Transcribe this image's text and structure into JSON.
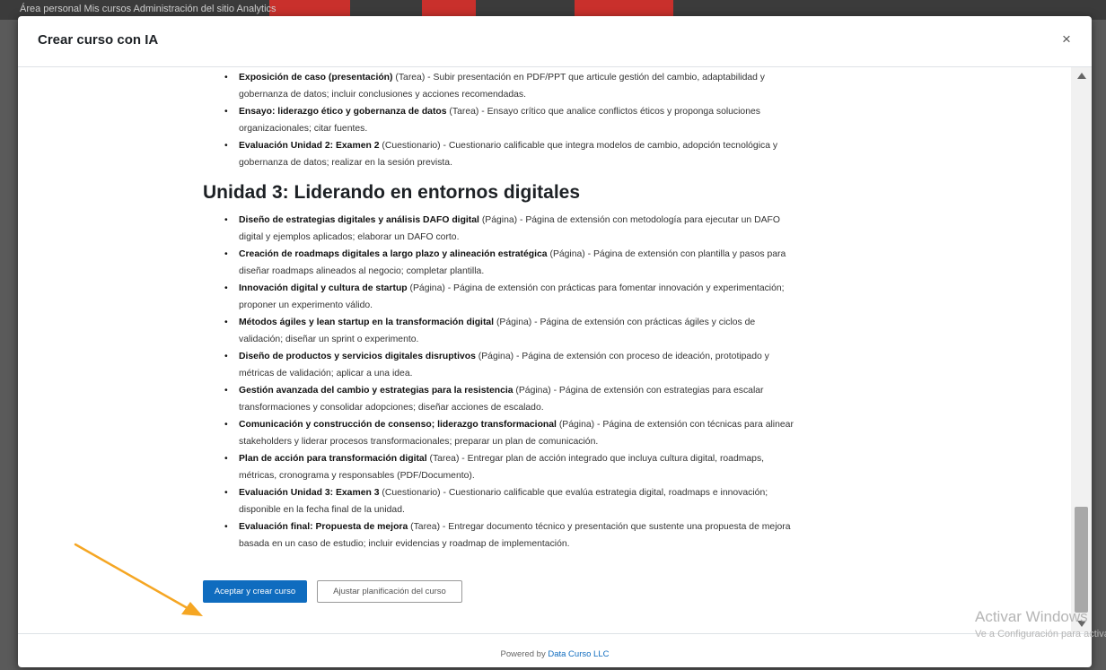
{
  "background": {
    "nav_text": "Área personal   Mis cursos   Administración del sitio   Analytics"
  },
  "modal": {
    "title": "Crear curso con IA",
    "close_label": "×"
  },
  "unit2_items": [
    {
      "title": "Exposición de caso (presentación)",
      "rest": " (Tarea) - Subir presentación en PDF/PPT que articule gestión del cambio, adaptabilidad y",
      "rest2": "gobernanza de datos; incluir conclusiones y acciones recomendadas."
    },
    {
      "title": "Ensayo: liderazgo ético y gobernanza de datos",
      "rest": " (Tarea) - Ensayo crítico que analice conflictos éticos y proponga soluciones",
      "rest2": "organizacionales; citar fuentes."
    },
    {
      "title": "Evaluación Unidad 2: Examen 2",
      "rest": " (Cuestionario) - Cuestionario calificable que integra modelos de cambio, adopción tecnológica y",
      "rest2": "gobernanza de datos; realizar en la sesión prevista."
    }
  ],
  "unit3": {
    "heading": "Unidad 3: Liderando en entornos digitales",
    "items": [
      {
        "title": "Diseño de estrategias digitales y análisis DAFO digital",
        "rest": " (Página) - Página de extensión con metodología para ejecutar un DAFO",
        "rest2": "digital y ejemplos aplicados; elaborar un DAFO corto."
      },
      {
        "title": "Creación de roadmaps digitales a largo plazo y alineación estratégica",
        "rest": " (Página) - Página de extensión con plantilla y pasos para",
        "rest2": "diseñar roadmaps alineados al negocio; completar plantilla."
      },
      {
        "title": "Innovación digital y cultura de startup",
        "rest": " (Página) - Página de extensión con prácticas para fomentar innovación y experimentación;",
        "rest2": "proponer un experimento válido."
      },
      {
        "title": "Métodos ágiles y lean startup en la transformación digital",
        "rest": " (Página) - Página de extensión con prácticas ágiles y ciclos de",
        "rest2": "validación; diseñar un sprint o experimento."
      },
      {
        "title": "Diseño de productos y servicios digitales disruptivos",
        "rest": " (Página) - Página de extensión con proceso de ideación, prototipado y",
        "rest2": "métricas de validación; aplicar a una idea."
      },
      {
        "title": "Gestión avanzada del cambio y estrategias para la resistencia",
        "rest": " (Página) - Página de extensión con estrategias para escalar",
        "rest2": "transformaciones y consolidar adopciones; diseñar acciones de escalado."
      },
      {
        "title": "Comunicación y construcción de consenso; liderazgo transformacional",
        "rest": " (Página) - Página de extensión con técnicas para alinear",
        "rest2": "stakeholders y liderar procesos transformacionales; preparar un plan de comunicación."
      },
      {
        "title": "Plan de acción para transformación digital",
        "rest": " (Tarea) - Entregar plan de acción integrado que incluya cultura digital, roadmaps,",
        "rest2": "métricas, cronograma y responsables (PDF/Documento)."
      },
      {
        "title": "Evaluación Unidad 3: Examen 3",
        "rest": " (Cuestionario) - Cuestionario calificable que evalúa estrategia digital, roadmaps e innovación;",
        "rest2": "disponible en la fecha final de la unidad."
      },
      {
        "title": "Evaluación final: Propuesta de mejora",
        "rest": " (Tarea) - Entregar documento técnico y presentación que sustente una propuesta de mejora",
        "rest2": "basada en un caso de estudio; incluir evidencias y roadmap de implementación."
      }
    ]
  },
  "actions": {
    "accept_label": "Aceptar y crear curso",
    "adjust_label": "Ajustar planificación del curso"
  },
  "footer": {
    "powered_prefix": "Powered by ",
    "powered_link": "Data Curso LLC"
  },
  "watermark": {
    "line1": "Activar Windows",
    "line2": "Ve a Configuración para activar Windows."
  },
  "colors": {
    "primary": "#0f6cbf",
    "annotation_arrow": "#f5a623"
  }
}
